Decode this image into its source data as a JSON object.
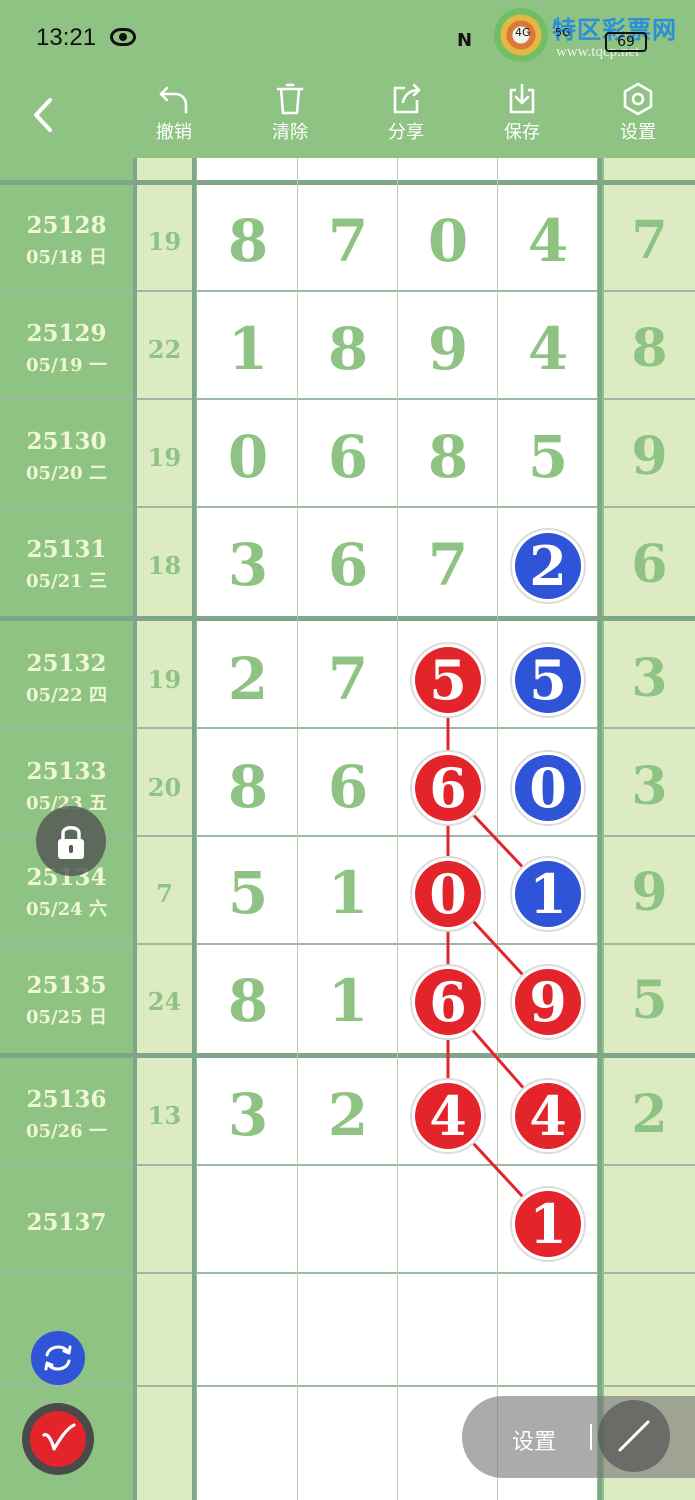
{
  "status": {
    "time": "13:21",
    "battery": "69",
    "signal1": "4G",
    "signal2": "5G"
  },
  "watermark": {
    "name": "特区彩票网",
    "url": "www.tqcp.net"
  },
  "toolbar": {
    "undo_label": "撤销",
    "clear_label": "清除",
    "share_label": "分享",
    "save_label": "保存",
    "settings_label": "设置"
  },
  "rows": [
    {
      "period": "25128",
      "date": "05/18 日",
      "sum": "19",
      "digits": [
        "8",
        "7",
        "0",
        "4"
      ],
      "extra": "7"
    },
    {
      "period": "25129",
      "date": "05/19 一",
      "sum": "22",
      "digits": [
        "1",
        "8",
        "9",
        "4"
      ],
      "extra": "8"
    },
    {
      "period": "25130",
      "date": "05/20 二",
      "sum": "19",
      "digits": [
        "0",
        "6",
        "8",
        "5"
      ],
      "extra": "9"
    },
    {
      "period": "25131",
      "date": "05/21 三",
      "sum": "18",
      "digits": [
        "3",
        "6",
        "7",
        "2"
      ],
      "extra": "6"
    },
    {
      "period": "25132",
      "date": "05/22 四",
      "sum": "19",
      "digits": [
        "2",
        "7",
        "5",
        "5"
      ],
      "extra": "3"
    },
    {
      "period": "25133",
      "date": "05/23 五",
      "sum": "20",
      "digits": [
        "8",
        "6",
        "6",
        "0"
      ],
      "extra": "3"
    },
    {
      "period": "25134",
      "date": "05/24 六",
      "sum": "7",
      "digits": [
        "5",
        "1",
        "0",
        "1"
      ],
      "extra": "9"
    },
    {
      "period": "25135",
      "date": "05/25 日",
      "sum": "24",
      "digits": [
        "8",
        "1",
        "6",
        "9"
      ],
      "extra": "5"
    },
    {
      "period": "25136",
      "date": "05/26 一",
      "sum": "13",
      "digits": [
        "3",
        "2",
        "4",
        "4"
      ],
      "extra": "2"
    },
    {
      "period": "25137",
      "date": "",
      "sum": "",
      "digits": [
        "",
        "",
        "",
        "1"
      ],
      "extra": ""
    }
  ],
  "marks": {
    "blue_color": "#2f54d8",
    "red_color": "#e3242b",
    "blue": [
      {
        "row": 3,
        "col": 3
      },
      {
        "row": 4,
        "col": 3
      },
      {
        "row": 5,
        "col": 3
      },
      {
        "row": 6,
        "col": 3
      }
    ],
    "red": [
      {
        "row": 4,
        "col": 2
      },
      {
        "row": 5,
        "col": 2
      },
      {
        "row": 6,
        "col": 2
      },
      {
        "row": 7,
        "col": 2
      },
      {
        "row": 8,
        "col": 2
      },
      {
        "row": 7,
        "col": 3
      },
      {
        "row": 8,
        "col": 3
      },
      {
        "row": 9,
        "col": 3
      }
    ]
  },
  "float_menu": {
    "settings_label": "设置"
  }
}
